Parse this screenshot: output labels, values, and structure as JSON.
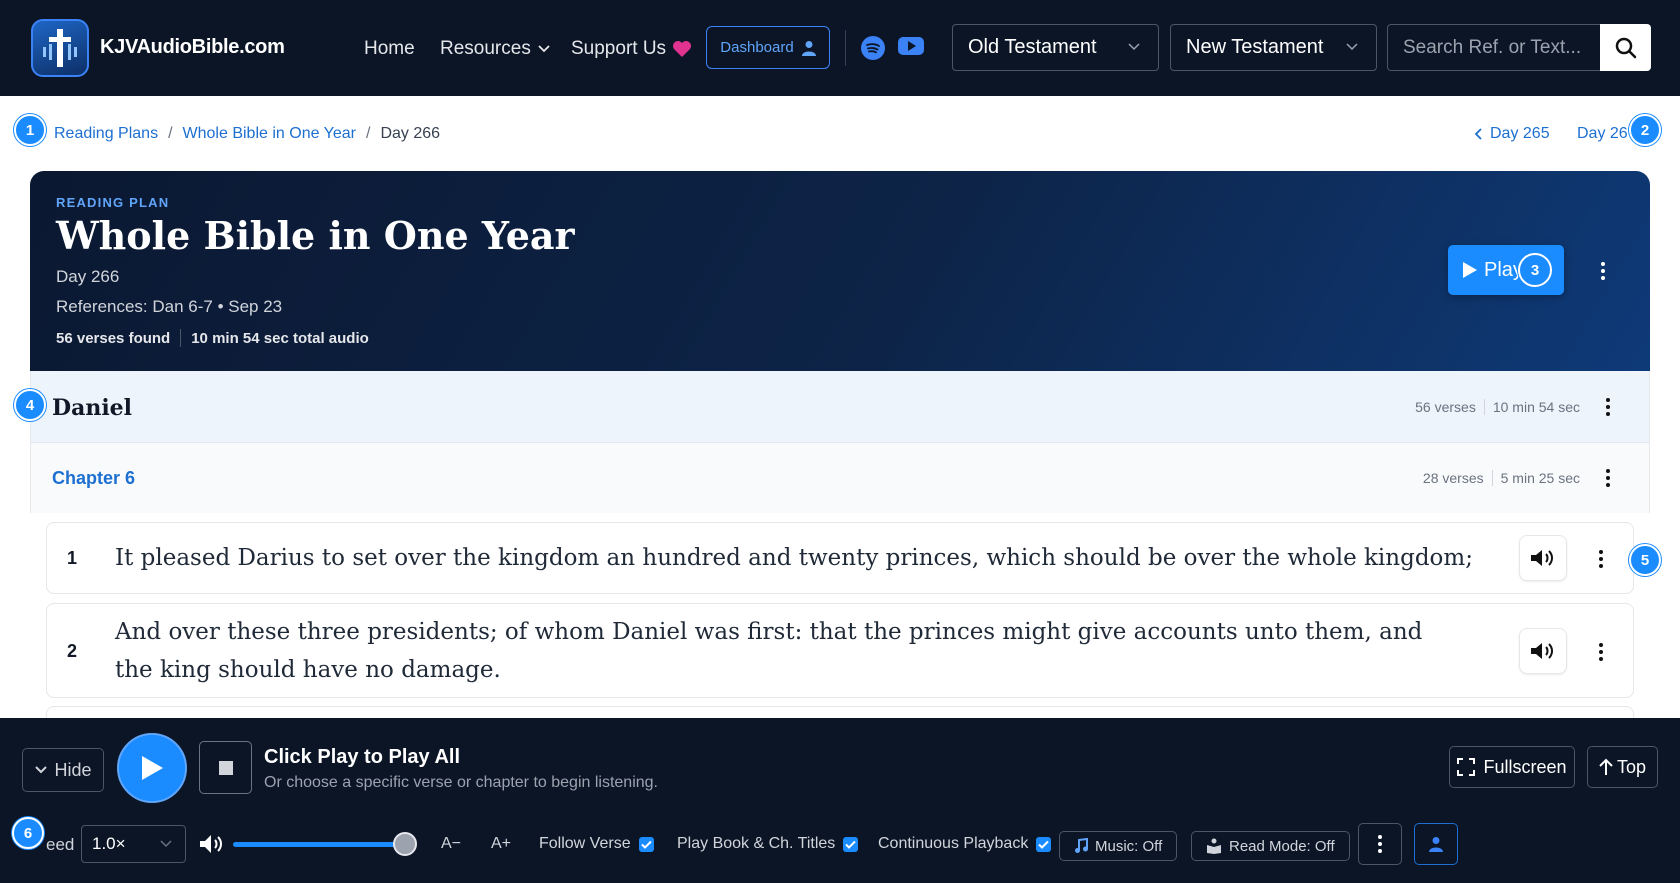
{
  "brand": {
    "name": "KJVAudioBible.com"
  },
  "nav": {
    "home": "Home",
    "resources": "Resources",
    "support": "Support Us",
    "dashboard": "Dashboard",
    "old_testament": "Old Testament",
    "new_testament": "New Testament",
    "search_placeholder": "Search Ref. or Text..."
  },
  "breadcrumb": {
    "items": [
      "Reading Plans",
      "Whole Bible in One Year",
      "Day 266"
    ],
    "prev_day": "Day 265",
    "next_day": "Day 26"
  },
  "markers": [
    "1",
    "2",
    "3",
    "4",
    "5",
    "6"
  ],
  "hero": {
    "eyebrow": "READING PLAN",
    "title": "Whole Bible in One Year",
    "day": "Day 266",
    "references": "References: Dan 6-7 • Sep 23",
    "verses_found": "56 verses found",
    "total_audio": "10 min 54 sec total audio",
    "play_label": "Play"
  },
  "book": {
    "name": "Daniel",
    "verses": "56 verses",
    "duration": "10 min 54 sec"
  },
  "chapter": {
    "name": "Chapter 6",
    "verses": "28 verses",
    "duration": "5 min 25 sec"
  },
  "verses": [
    {
      "num": "1",
      "text": "It pleased Darius to set over the kingdom an hundred and twenty princes, which should be over the whole kingdom;"
    },
    {
      "num": "2",
      "text": "And over these three presidents; of whom Daniel was first: that the princes might give accounts unto them, and the king should have no damage."
    }
  ],
  "player": {
    "hide": "Hide",
    "title": "Click Play to Play All",
    "subtitle": "Or choose a specific verse or chapter to begin listening.",
    "fullscreen": "Fullscreen",
    "top": "Top",
    "speed_label": "eed",
    "speed_value": "1.0×",
    "volume": 1.0,
    "font_minus": "A−",
    "font_plus": "A+",
    "follow_verse": "Follow Verse",
    "play_titles": "Play Book & Ch. Titles",
    "continuous": "Continuous Playback",
    "music": "Music: Off",
    "read_mode": "Read Mode: Off"
  },
  "colors": {
    "nav_bg": "#0b1526",
    "accent": "#1a8cff",
    "link": "#1d6fd1",
    "support_heart": "#e0338f"
  }
}
